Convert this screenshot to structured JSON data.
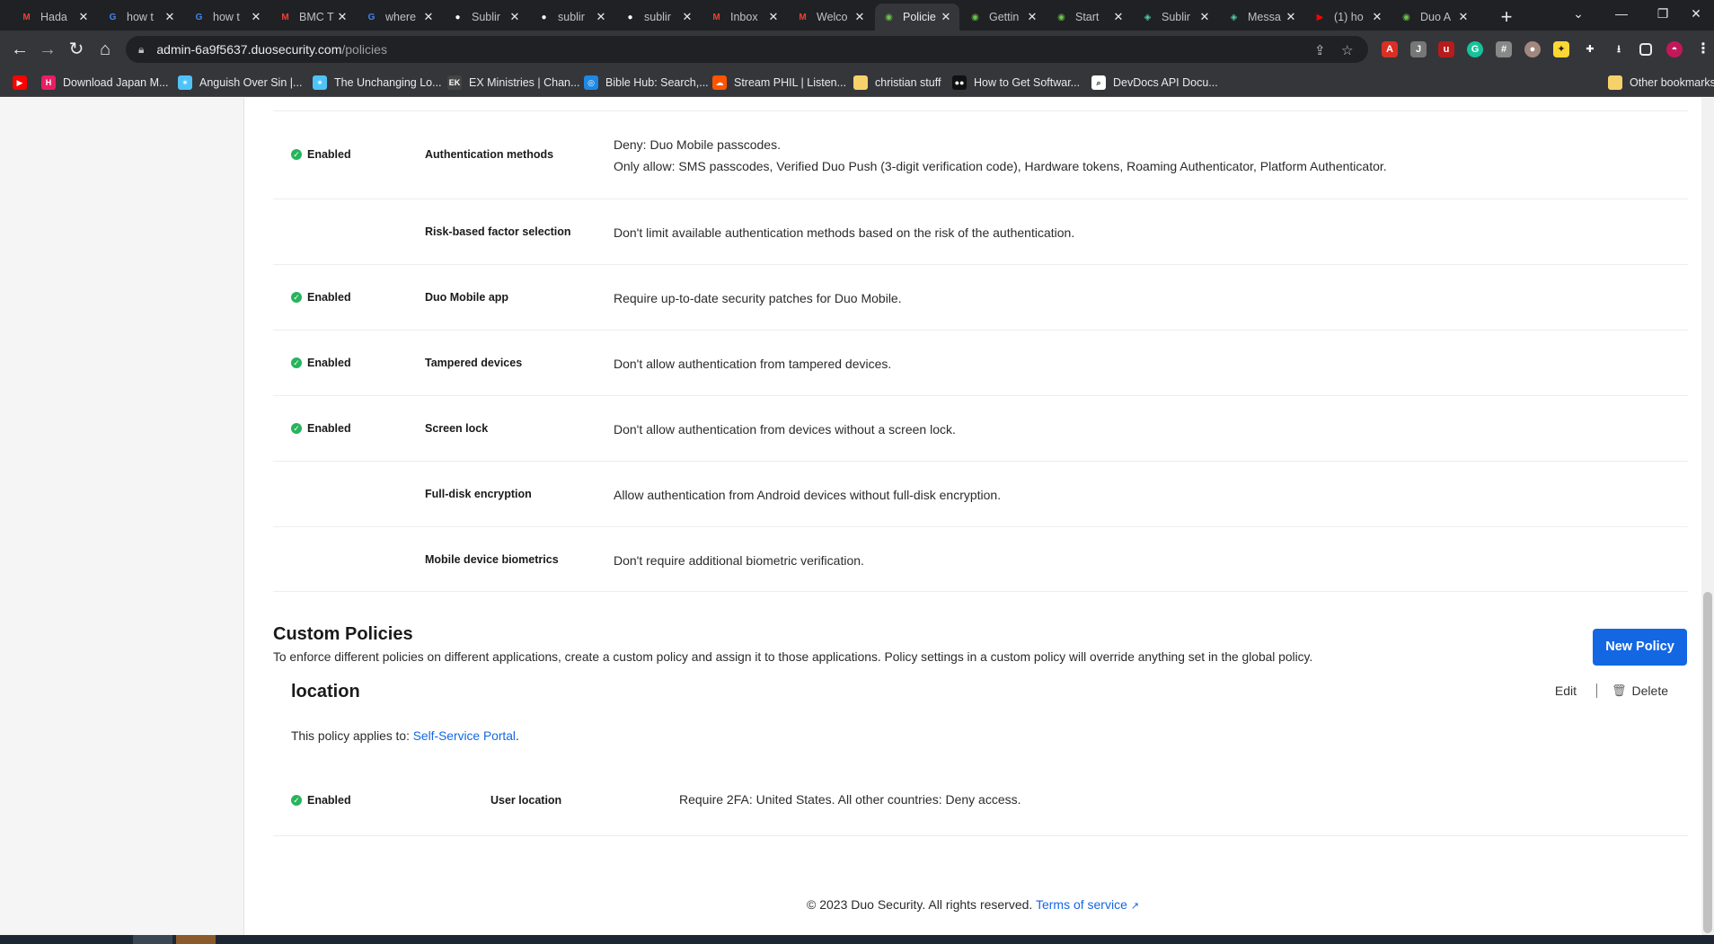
{
  "browser": {
    "tabs": [
      {
        "title": "Hada",
        "icon": "gmail-icon",
        "color": "#ea4335"
      },
      {
        "title": "how t",
        "icon": "google-icon",
        "color": "#4285f4"
      },
      {
        "title": "how t",
        "icon": "google-icon",
        "color": "#4285f4"
      },
      {
        "title": "BMC T",
        "icon": "gmail-icon",
        "color": "#ea4335"
      },
      {
        "title": "where",
        "icon": "google-icon",
        "color": "#4285f4"
      },
      {
        "title": "Sublir",
        "icon": "github-icon",
        "color": "#ffffff"
      },
      {
        "title": "sublir",
        "icon": "github-icon",
        "color": "#ffffff"
      },
      {
        "title": "sublir",
        "icon": "github-icon",
        "color": "#ffffff"
      },
      {
        "title": "Inbox",
        "icon": "gmail-icon",
        "color": "#ea4335"
      },
      {
        "title": "Welco",
        "icon": "gmail-icon",
        "color": "#ea4335"
      },
      {
        "title": "Policie",
        "icon": "duo-icon",
        "color": "#6bc24c",
        "active": true
      },
      {
        "title": "Gettin",
        "icon": "duo-icon",
        "color": "#6bc24c"
      },
      {
        "title": "Start",
        "icon": "duo-icon",
        "color": "#6bc24c"
      },
      {
        "title": "Sublir",
        "icon": "sublime-icon",
        "color": "#4dd0a1"
      },
      {
        "title": "Messa",
        "icon": "sublime-icon",
        "color": "#4dd0a1"
      },
      {
        "title": "(1) ho",
        "icon": "youtube-icon",
        "color": "#ff0000"
      },
      {
        "title": "Duo A",
        "icon": "duo-icon",
        "color": "#6bc24c"
      }
    ],
    "url_host": "admin-6a9f5637.duosecurity.com",
    "url_path": "/policies",
    "bookmarks": [
      {
        "label": "",
        "icon": "youtube-icon",
        "color": "#ff0000"
      },
      {
        "label": "Download Japan M...",
        "icon": "h-icon",
        "color": "#e91e63"
      },
      {
        "label": "Anguish Over Sin |...",
        "icon": "star-icon",
        "color": "#4fc3f7"
      },
      {
        "label": "The Unchanging Lo...",
        "icon": "star-icon",
        "color": "#4fc3f7"
      },
      {
        "label": "EX Ministries | Chan...",
        "icon": "ek-icon",
        "color": "#444444"
      },
      {
        "label": "Bible Hub: Search,...",
        "icon": "globe-icon",
        "color": "#1e88e5"
      },
      {
        "label": "Stream PHIL | Listen...",
        "icon": "soundcloud-icon",
        "color": "#ff5500"
      },
      {
        "label": "christian stuff",
        "icon": "folder-icon",
        "color": "#f6d26b"
      },
      {
        "label": "How to Get Softwar...",
        "icon": "medium-icon",
        "color": "#111111"
      },
      {
        "label": "DevDocs API Docu...",
        "icon": "search-icon",
        "color": "#ffffff"
      }
    ],
    "other_bookmarks": "Other bookmarks"
  },
  "global_policy_rows": [
    {
      "status": "Enabled",
      "label": "Authentication methods",
      "lines": [
        "Deny: Duo Mobile passcodes.",
        "Only allow: SMS passcodes, Verified Duo Push (3-digit verification code), Hardware tokens, Roaming Authenticator, Platform Authenticator."
      ]
    },
    {
      "status": "",
      "label": "Risk-based factor selection",
      "lines": [
        "Don't limit available authentication methods based on the risk of the authentication."
      ]
    },
    {
      "status": "Enabled",
      "label": "Duo Mobile app",
      "lines": [
        "Require up-to-date security patches for Duo Mobile."
      ]
    },
    {
      "status": "Enabled",
      "label": "Tampered devices",
      "lines": [
        "Don't allow authentication from tampered devices."
      ]
    },
    {
      "status": "Enabled",
      "label": "Screen lock",
      "lines": [
        "Don't allow authentication from devices without a screen lock."
      ]
    },
    {
      "status": "",
      "label": "Full-disk encryption",
      "lines": [
        "Allow authentication from Android devices without full-disk encryption."
      ]
    },
    {
      "status": "",
      "label": "Mobile device biometrics",
      "lines": [
        "Don't require additional biometric verification."
      ]
    }
  ],
  "custom_policies": {
    "title": "Custom Policies",
    "description": "To enforce different policies on different applications, create a custom policy and assign it to those applications. Policy settings in a custom policy will override anything set in the global policy.",
    "new_button": "New Policy"
  },
  "location_policy": {
    "name": "location",
    "edit": "Edit",
    "delete": "Delete",
    "applies_prefix": "This policy applies to: ",
    "applies_link": "Self-Service Portal",
    "applies_suffix": ".",
    "row": {
      "status": "Enabled",
      "label": "User location",
      "value": "Require 2FA: United States. All other countries: Deny access."
    }
  },
  "footer": {
    "copyright": "© 2023 Duo Security. All rights reserved.",
    "terms": "Terms of service"
  },
  "colors": {
    "accent": "#1467e3",
    "enabled": "#26b45c"
  }
}
